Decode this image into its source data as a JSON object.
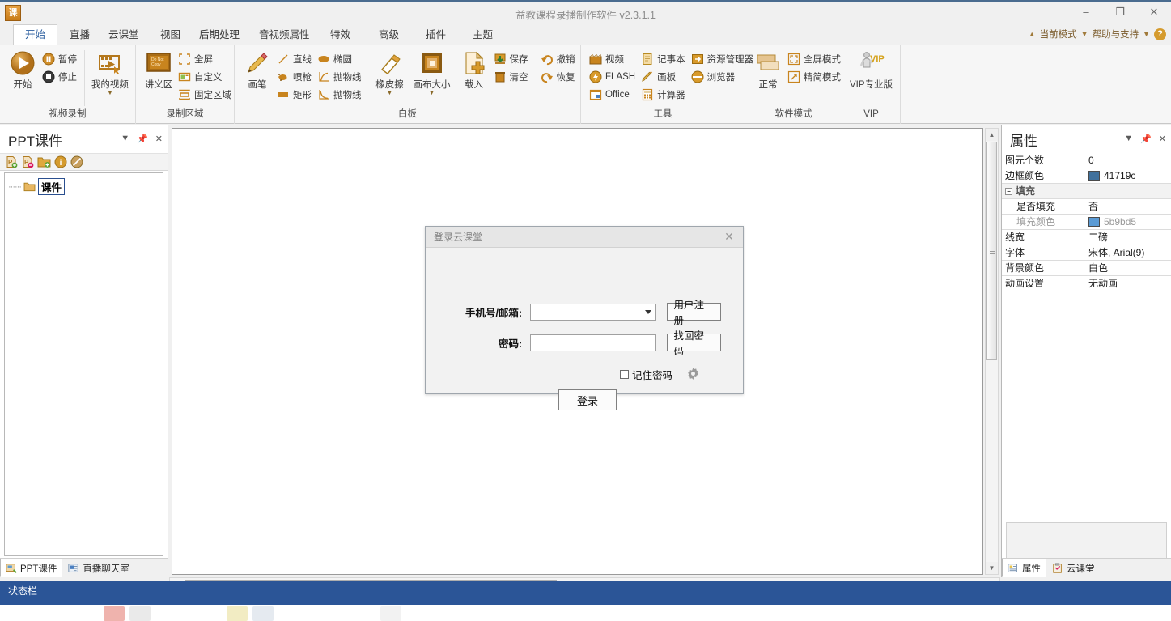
{
  "window": {
    "title": "益教课程录播制作软件 v2.3.1.1",
    "app_icon": "课",
    "minimize": "–",
    "maximize": "❐",
    "close": "✕"
  },
  "ribbon": {
    "tabs": [
      {
        "label": "开始",
        "active": true
      },
      {
        "label": "直播",
        "active": false
      },
      {
        "label": "云课堂",
        "active": false
      },
      {
        "label": "视图",
        "active": false
      },
      {
        "label": "后期处理",
        "active": false
      },
      {
        "label": "音视频属性",
        "active": false
      },
      {
        "label": "特效",
        "active": false
      },
      {
        "label": "高级",
        "active": false
      },
      {
        "label": "插件",
        "active": false
      },
      {
        "label": "主题",
        "active": false
      }
    ],
    "header_right": {
      "mode_label": "当前模式",
      "help_label": "帮助与支持",
      "help_icon": "?"
    },
    "groups": [
      {
        "name": "视频录制",
        "big": [
          {
            "label": "开始",
            "icon": "play-circle-icon"
          }
        ],
        "small": [
          {
            "label": "暂停",
            "icon": "pause-icon"
          },
          {
            "label": "停止",
            "icon": "stop-icon"
          }
        ],
        "big2": [
          {
            "label": "我的视频",
            "icon": "my-video-icon",
            "dropdown": true
          }
        ]
      },
      {
        "name": "录制区域",
        "big": [
          {
            "label": "讲义区",
            "icon": "lecture-area-icon"
          }
        ],
        "small": [
          {
            "label": "全屏",
            "icon": "fullscreen-icon"
          },
          {
            "label": "自定义",
            "icon": "custom-area-icon"
          },
          {
            "label": "固定区域",
            "icon": "fixed-area-icon"
          }
        ]
      },
      {
        "name": "白板",
        "big": [
          {
            "label": "画笔",
            "icon": "pencil-icon"
          }
        ],
        "small": [
          {
            "label": "直线",
            "icon": "line-icon"
          },
          {
            "label": "椭圆",
            "icon": "ellipse-icon"
          },
          {
            "label": "喷枪",
            "icon": "spray-icon"
          },
          {
            "label": "抛物线",
            "icon": "parabola-up-icon"
          },
          {
            "label": "矩形",
            "icon": "rectangle-icon"
          },
          {
            "label": "抛物线",
            "icon": "parabola-down-icon"
          }
        ],
        "big2": [
          {
            "label": "橡皮擦",
            "icon": "eraser-icon",
            "dropdown": true
          },
          {
            "label": "画布大小",
            "icon": "canvas-size-icon",
            "dropdown": true
          },
          {
            "label": "载入",
            "icon": "load-icon"
          }
        ],
        "small2": [
          {
            "label": "保存",
            "icon": "save-icon"
          },
          {
            "label": "清空",
            "icon": "clear-icon"
          },
          {
            "label": "撤销",
            "icon": "undo-icon"
          },
          {
            "label": "恢复",
            "icon": "redo-icon"
          }
        ]
      },
      {
        "name": "工具",
        "small": [
          {
            "label": "视频",
            "icon": "video-icon"
          },
          {
            "label": "记事本",
            "icon": "notepad-icon"
          },
          {
            "label": "资源管理器",
            "icon": "explorer-icon"
          },
          {
            "label": "FLASH",
            "icon": "flash-icon"
          },
          {
            "label": "画板",
            "icon": "paintboard-icon"
          },
          {
            "label": "浏览器",
            "icon": "browser-icon"
          },
          {
            "label": "Office",
            "icon": "office-icon"
          },
          {
            "label": "计算器",
            "icon": "calculator-icon"
          }
        ]
      },
      {
        "name": "软件模式",
        "big": [
          {
            "label": "正常",
            "icon": "normal-mode-icon"
          }
        ],
        "small": [
          {
            "label": "全屏模式",
            "icon": "fullscreen-mode-icon"
          },
          {
            "label": "精简模式",
            "icon": "compact-mode-icon"
          }
        ]
      },
      {
        "name": "VIP",
        "big": [
          {
            "label": "VIP专业版",
            "icon": "vip-icon"
          }
        ]
      }
    ]
  },
  "left_panel": {
    "title": "PPT课件",
    "header_buttons": [
      "chevron-down-icon",
      "pin-icon",
      "close-icon"
    ],
    "toolbar_icons": [
      "add-ppt-icon",
      "remove-ppt-icon",
      "add-folder-icon",
      "info-icon",
      "disable-icon"
    ],
    "tree": {
      "root_label": "课件",
      "folder_icon": "folder-icon"
    },
    "tabs": [
      {
        "label": "PPT课件",
        "icon": "ppt-icon",
        "active": true
      },
      {
        "label": "直播聊天室",
        "icon": "chat-icon",
        "active": false
      }
    ]
  },
  "right_panel": {
    "title": "属性",
    "header_buttons": [
      "chevron-down-icon",
      "pin-icon",
      "close-icon"
    ],
    "rows": [
      {
        "key": "图元个数",
        "value": "0",
        "kind": "text"
      },
      {
        "key": "边框颜色",
        "value": "41719c",
        "kind": "color",
        "color": "#41719c"
      },
      {
        "key": "填充",
        "value": "",
        "kind": "group"
      },
      {
        "key": "是否填充",
        "value": "否",
        "kind": "text",
        "indent": true
      },
      {
        "key": "填充颜色",
        "value": "5b9bd5",
        "kind": "color",
        "color": "#5b9bd5",
        "indent": true,
        "dim": true
      },
      {
        "key": "线宽",
        "value": "二磅",
        "kind": "text"
      },
      {
        "key": "字体",
        "value": "宋体, Arial(9)",
        "kind": "text"
      },
      {
        "key": "背景颜色",
        "value": "白色",
        "kind": "text"
      },
      {
        "key": "动画设置",
        "value": "无动画",
        "kind": "text"
      }
    ],
    "tabs": [
      {
        "label": "属性",
        "icon": "properties-icon",
        "active": true
      },
      {
        "label": "云课堂",
        "icon": "cloud-class-icon",
        "active": false
      }
    ]
  },
  "dialog": {
    "title": "登录云课堂",
    "close_icon": "close-icon",
    "phone_label": "手机号/邮箱:",
    "phone_value": "",
    "phone_placeholder": "",
    "register_button": "用户注册",
    "password_label": "密码:",
    "password_value": "",
    "password_placeholder": "",
    "forgot_button": "找回密码",
    "remember_label": "记住密码",
    "remember_checked": false,
    "settings_icon": "gear-icon",
    "login_button": "登录"
  },
  "status_bar": {
    "text": "状态栏"
  },
  "colors": {
    "accent": "#2b5597",
    "ribbon_bg": "#f6f6f6",
    "border_color_swatch": "#41719c",
    "fill_color_swatch": "#5b9bd5",
    "icon_orange": "#c8841e"
  }
}
